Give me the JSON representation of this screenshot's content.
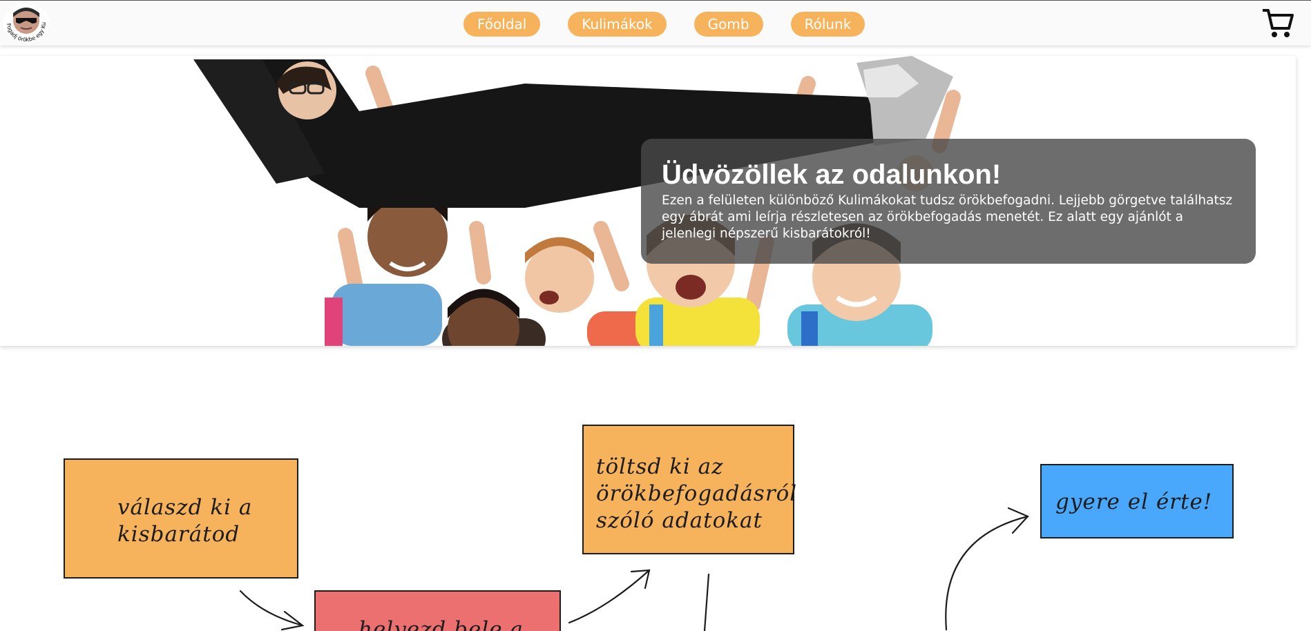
{
  "header": {
    "logo_text": "Fogadj örökbe egy Kulimákot",
    "nav": [
      {
        "label": "Főoldal"
      },
      {
        "label": "Kulimákok"
      },
      {
        "label": "Gomb"
      },
      {
        "label": "Rólunk"
      }
    ],
    "cart_icon": "shopping-cart-icon"
  },
  "hero": {
    "title": "Üdvözöllek az odalunkon!",
    "text": "Ezen a felületen különböző Kulimákokat tudsz örökbefogadni. Lejjebb görgetve találhatsz egy ábrát ami leírja részletesen az örökbefogadás menetét. Ez alatt egy ajánlót a jelenlegi népszerű kisbarátokról!"
  },
  "flow": {
    "steps": [
      {
        "text": "válaszd ki a kisbarátod"
      },
      {
        "text": "helyezd bele a"
      },
      {
        "text": "töltsd ki az örökbefogadásról szóló adatokat"
      },
      {
        "text": "gyere el érte!"
      }
    ]
  },
  "colors": {
    "accent": "#f7b35b",
    "step_red": "#ec7070",
    "step_blue": "#49a8fb",
    "overlay": "#484848"
  }
}
